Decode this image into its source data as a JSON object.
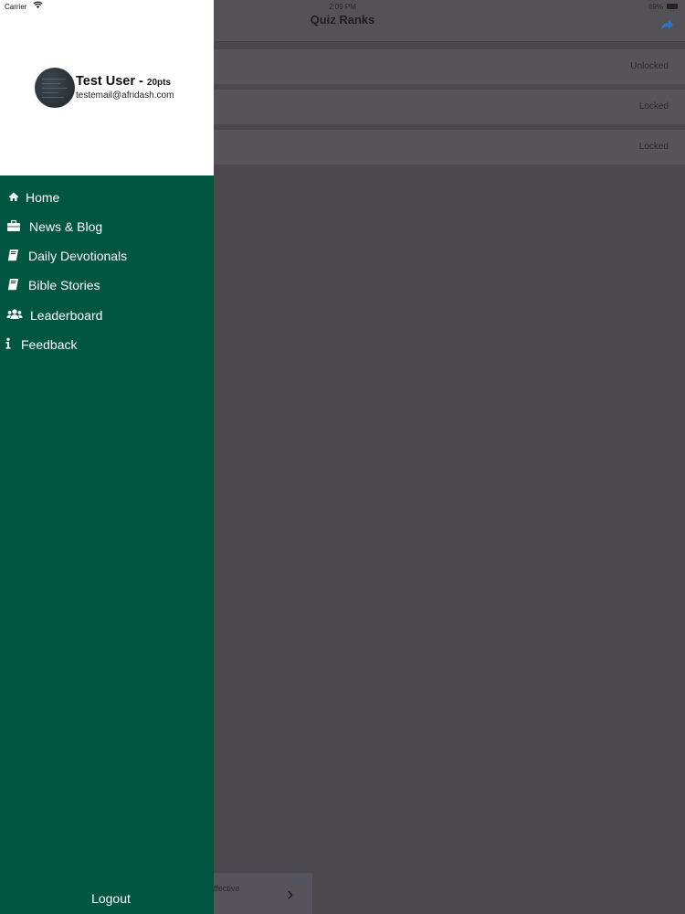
{
  "status_bar": {
    "carrier": "Carrier",
    "time": "2:09 PM",
    "battery": "69%"
  },
  "navbar": {
    "title": "Quiz Ranks"
  },
  "ranks": [
    {
      "status": "Unlocked"
    },
    {
      "status": "Locked"
    },
    {
      "status": "Locked"
    }
  ],
  "ad": {
    "text": "ffective",
    "choices": "ⓘ x",
    "chevron": "›"
  },
  "drawer": {
    "user": {
      "name": "Test User -",
      "points": "20pts",
      "email": "testemail@afridash.com"
    },
    "menu": [
      {
        "label": "Home",
        "icon": "home-icon"
      },
      {
        "label": "News & Blog",
        "icon": "briefcase-icon"
      },
      {
        "label": "Daily Devotionals",
        "icon": "book-icon"
      },
      {
        "label": "Bible Stories",
        "icon": "book-icon"
      },
      {
        "label": "Leaderboard",
        "icon": "users-icon"
      },
      {
        "label": "Feedback",
        "icon": "info-icon"
      }
    ],
    "logout": "Logout"
  },
  "colors": {
    "drawer_bg": "#005640",
    "overlay_bg": "#4a484c",
    "share_icon": "#2a74c9"
  }
}
